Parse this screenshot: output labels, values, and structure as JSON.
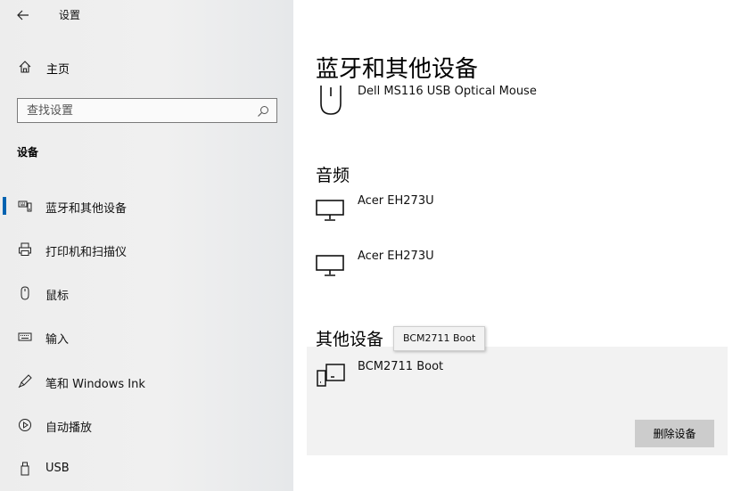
{
  "window": {
    "title": "设置"
  },
  "sidebar": {
    "home_label": "主页",
    "search": {
      "placeholder": "查找设置"
    },
    "section_heading": "设备",
    "items": [
      {
        "label": "蓝牙和其他设备",
        "icon": "bluetooth-devices-icon",
        "selected": true
      },
      {
        "label": "打印机和扫描仪",
        "icon": "printer-icon",
        "selected": false
      },
      {
        "label": "鼠标",
        "icon": "mouse-icon",
        "selected": false
      },
      {
        "label": "输入",
        "icon": "keyboard-icon",
        "selected": false
      },
      {
        "label": "笔和 Windows Ink",
        "icon": "pen-icon",
        "selected": false
      },
      {
        "label": "自动播放",
        "icon": "autoplay-icon",
        "selected": false
      },
      {
        "label": "USB",
        "icon": "usb-icon",
        "selected": false
      }
    ]
  },
  "main": {
    "page_title": "蓝牙和其他设备",
    "mouse_devices": [
      {
        "name": "Dell MS116 USB Optical Mouse",
        "icon": "mouse-icon"
      }
    ],
    "audio": {
      "heading": "音频",
      "devices": [
        {
          "name": "Acer EH273U",
          "icon": "monitor-icon"
        },
        {
          "name": "Acer EH273U",
          "icon": "monitor-icon"
        }
      ]
    },
    "other": {
      "heading": "其他设备",
      "devices": [
        {
          "name": "BCM2711 Boot",
          "icon": "device-icon",
          "selected": true
        }
      ],
      "remove_label": "删除设备"
    }
  },
  "tooltip": {
    "text": "BCM2711 Boot"
  },
  "colors": {
    "accent": "#0063b1",
    "selected_background": "#f2f2f2",
    "button_background": "#cccccc"
  }
}
